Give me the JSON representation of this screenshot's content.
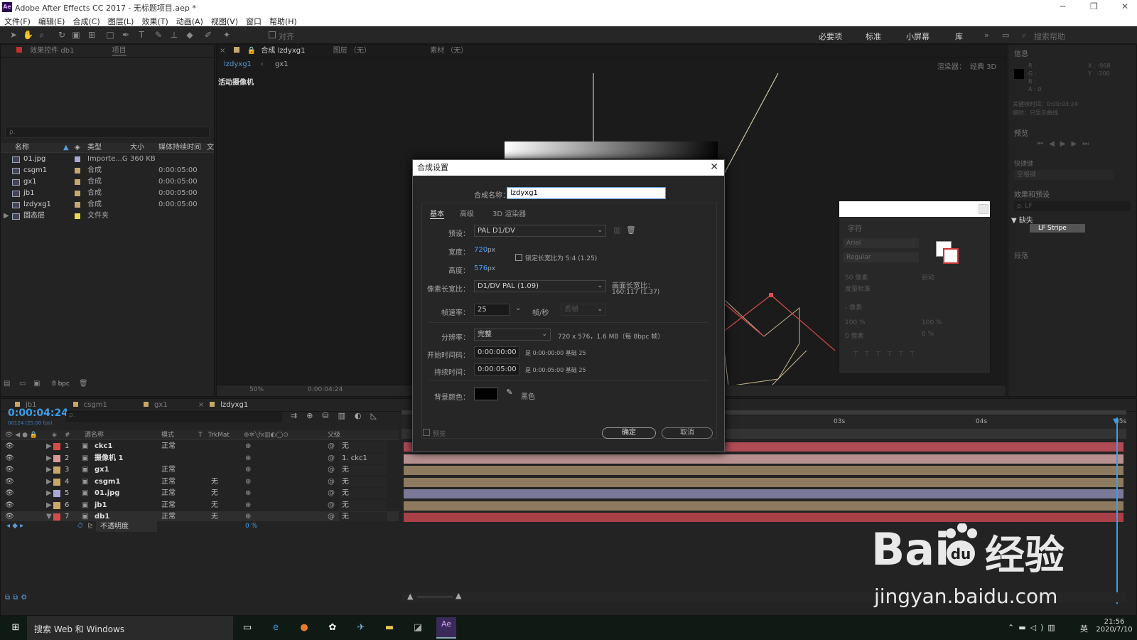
{
  "app": {
    "title": "Adobe After Effects CC 2017 - 无标题项目.aep *",
    "logo": "Ae"
  },
  "menu": [
    "文件(F)",
    "编辑(E)",
    "合成(C)",
    "图层(L)",
    "效果(T)",
    "动画(A)",
    "视图(V)",
    "窗口",
    "帮助(H)"
  ],
  "toolbar": {
    "align_label": "对齐",
    "workspaces": [
      "必要项",
      "标准",
      "小屏幕",
      "库"
    ],
    "search_placeholder": "搜索帮助"
  },
  "left_panel": {
    "tab1": "效果控件 db1",
    "tab2": "项目",
    "search_placeholder": "ρ.",
    "columns": [
      "名称",
      "类型",
      "大小",
      "媒体持续时间",
      "文"
    ],
    "items": [
      {
        "name": "01.jpg",
        "type": "Importe...G",
        "size": "360 KB",
        "duration": "",
        "color": "#a8a8d8"
      },
      {
        "name": "csgm1",
        "type": "合成",
        "size": "",
        "duration": "0:00:05:00",
        "color": "#c8a86a"
      },
      {
        "name": "gx1",
        "type": "合成",
        "size": "",
        "duration": "0:00:05:00",
        "color": "#c8a86a"
      },
      {
        "name": "jb1",
        "type": "合成",
        "size": "",
        "duration": "0:00:05:00",
        "color": "#c8a86a"
      },
      {
        "name": "lzdyxg1",
        "type": "合成",
        "size": "",
        "duration": "0:00:05:00",
        "color": "#c8a86a"
      },
      {
        "name": "固态层",
        "type": "文件夹",
        "size": "",
        "duration": "",
        "color": "#e8d84a"
      }
    ],
    "bpc": "8 bpc"
  },
  "viewer": {
    "tab_comp": "合成 lzdyxg1",
    "tab_layer": "图层 （无）",
    "tab_footage": "素材 （无）",
    "crumb1": "lzdyxg1",
    "crumb2": "gx1",
    "camera": "活动摄像机",
    "renderer": "渲染器：",
    "renderer_val": "经典 3D",
    "zoom": "50%",
    "time": "0:00:04:24"
  },
  "dialog": {
    "title": "合成设置",
    "name_label": "合成名称：",
    "name_value": "lzdyxg1",
    "tabs": [
      "基本",
      "高级",
      "3D 渲染器"
    ],
    "preset_label": "预设：",
    "preset_value": "PAL D1/DV",
    "width_label": "宽度：",
    "width_value": "720",
    "px": "px",
    "height_label": "高度：",
    "height_value": "576",
    "lock_label": "锁定长宽比为 5:4 (1.25)",
    "par_label": "像素长宽比：",
    "par_value": "D1/DV PAL (1.09)",
    "far_label": "画面长宽比：",
    "far_value": "160:117 (1.37)",
    "fps_label": "帧速率：",
    "fps_value": "25",
    "fps_unit": "帧/秒",
    "drop_value": "丢帧",
    "res_label": "分辨率：",
    "res_value": "完整",
    "res_info": "720 x 576，1.6 MB（每 8bpc 帧）",
    "start_label": "开始时间码：",
    "start_value": "0:00:00:00",
    "start_info": "是 0:00:00:00  基础 25",
    "dur_label": "持续时间：",
    "dur_value": "0:00:05:00",
    "dur_info": "是 0:00:05:00  基础 25",
    "bg_label": "背景颜色：",
    "bg_name": "黑色",
    "preview_label": "预览",
    "ok": "确定",
    "cancel": "取消"
  },
  "right_panel": {
    "info": "信息",
    "info_rgb": [
      "R :",
      "G :",
      "B :",
      "A : 0"
    ],
    "info_xy": [
      "X : -968",
      "Y : -200"
    ],
    "info_text1": "关键帧时间：0:00:03:24",
    "info_text2": "缩时：只显示曲线",
    "preview": "预览",
    "shortcut": "快捷键",
    "shortcut_val": "空格键",
    "effects": "效果和预设",
    "effects_search": "ρ. LF",
    "effects_cat": "▼ 缺失",
    "effects_item": "LF Stripe",
    "para": "段落",
    "char": "字符",
    "font": "Arial",
    "style": "Regular",
    "size": "50 像素",
    "auto": "自动",
    "metric": "度量标准",
    "px_label": "- 像素",
    "pct1": "100 %",
    "pct2": "100 %",
    "base": "0 像素",
    "tsume": "0 %"
  },
  "timeline": {
    "tabs": [
      "jb1",
      "csgm1",
      "gx1",
      "lzdyxg1"
    ],
    "time": "0:00:04:24",
    "frames": "00124 (25.00 fps)",
    "headers": [
      "#",
      "源名称",
      "模式",
      "T",
      "TrkMat",
      "父级"
    ],
    "ruler": [
      "03s",
      "04s",
      "05s"
    ],
    "layers": [
      {
        "n": "1",
        "name": "ckc1",
        "mode": "正常",
        "trk": "",
        "parent": "无",
        "color": "#d84a4a",
        "bar": "#b04a55"
      },
      {
        "n": "2",
        "name": "摄像机 1",
        "mode": "",
        "trk": "",
        "parent": "1. ckc1",
        "color": "#d89898",
        "bar": "#b89090"
      },
      {
        "n": "3",
        "name": "gx1",
        "mode": "正常",
        "trk": "",
        "parent": "无",
        "color": "#c8a86a",
        "bar": "#8e7a5e"
      },
      {
        "n": "4",
        "name": "csgm1",
        "mode": "正常",
        "trk": "无",
        "parent": "无",
        "color": "#c8a86a",
        "bar": "#8e7a5e"
      },
      {
        "n": "5",
        "name": "01.jpg",
        "mode": "正常",
        "trk": "无",
        "parent": "无",
        "color": "#a8a8d8",
        "bar": "#7a7a98"
      },
      {
        "n": "6",
        "name": "jb1",
        "mode": "正常",
        "trk": "无",
        "parent": "无",
        "color": "#c8a86a",
        "bar": "#8e7a5e"
      },
      {
        "n": "7",
        "name": "db1",
        "mode": "正常",
        "trk": "无",
        "parent": "无",
        "color": "#d84a4a",
        "bar": "#a84048"
      }
    ],
    "prop_name": "不透明度",
    "prop_value": "0 %"
  },
  "taskbar": {
    "search": "搜索 Web 和 Windows",
    "time": "21:56",
    "date": "2020/7/10",
    "ime": "英"
  },
  "watermark": {
    "brand": "Bai",
    "brand2": "经验",
    "url": "jingyan.baidu.com"
  }
}
